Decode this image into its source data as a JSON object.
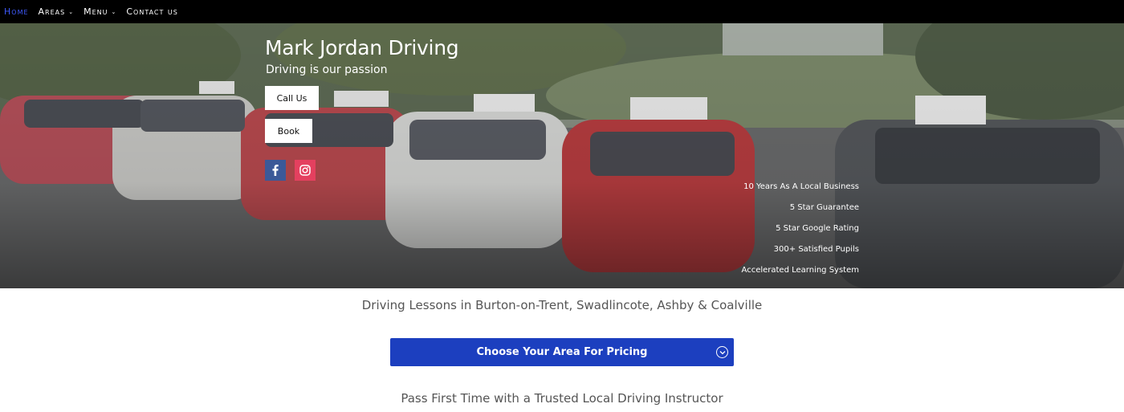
{
  "nav": {
    "items": [
      {
        "label": "Home",
        "active": true,
        "dropdown": false
      },
      {
        "label": "Areas",
        "active": false,
        "dropdown": true
      },
      {
        "label": "Menu",
        "active": false,
        "dropdown": true
      },
      {
        "label": "Contact us",
        "active": false,
        "dropdown": false
      }
    ],
    "active_color": "#3f5bff",
    "background": "#000000"
  },
  "hero": {
    "title": "Mark Jordan Driving",
    "subtitle": "Driving is our passion",
    "buttons": {
      "call": "Call Us",
      "book": "Book"
    },
    "social": [
      {
        "icon": "facebook-icon",
        "color": "#3b5998"
      },
      {
        "icon": "instagram-icon",
        "color": "#e4405f"
      }
    ],
    "features": [
      "10 Years As A Local Business",
      "5 Star Guarantee",
      "5 Star Google Rating",
      "300+ Satisfied Pupils",
      "Accelerated Learning System"
    ]
  },
  "main": {
    "lessons_heading": "Driving Lessons in Burton-on-Trent, Swadlincote, Ashby & Coalville",
    "pricing_button": "Choose Your Area For Pricing",
    "pricing_button_color": "#1c3fbf",
    "pass_heading": "Pass First Time with a Trusted Local Driving Instructor"
  }
}
